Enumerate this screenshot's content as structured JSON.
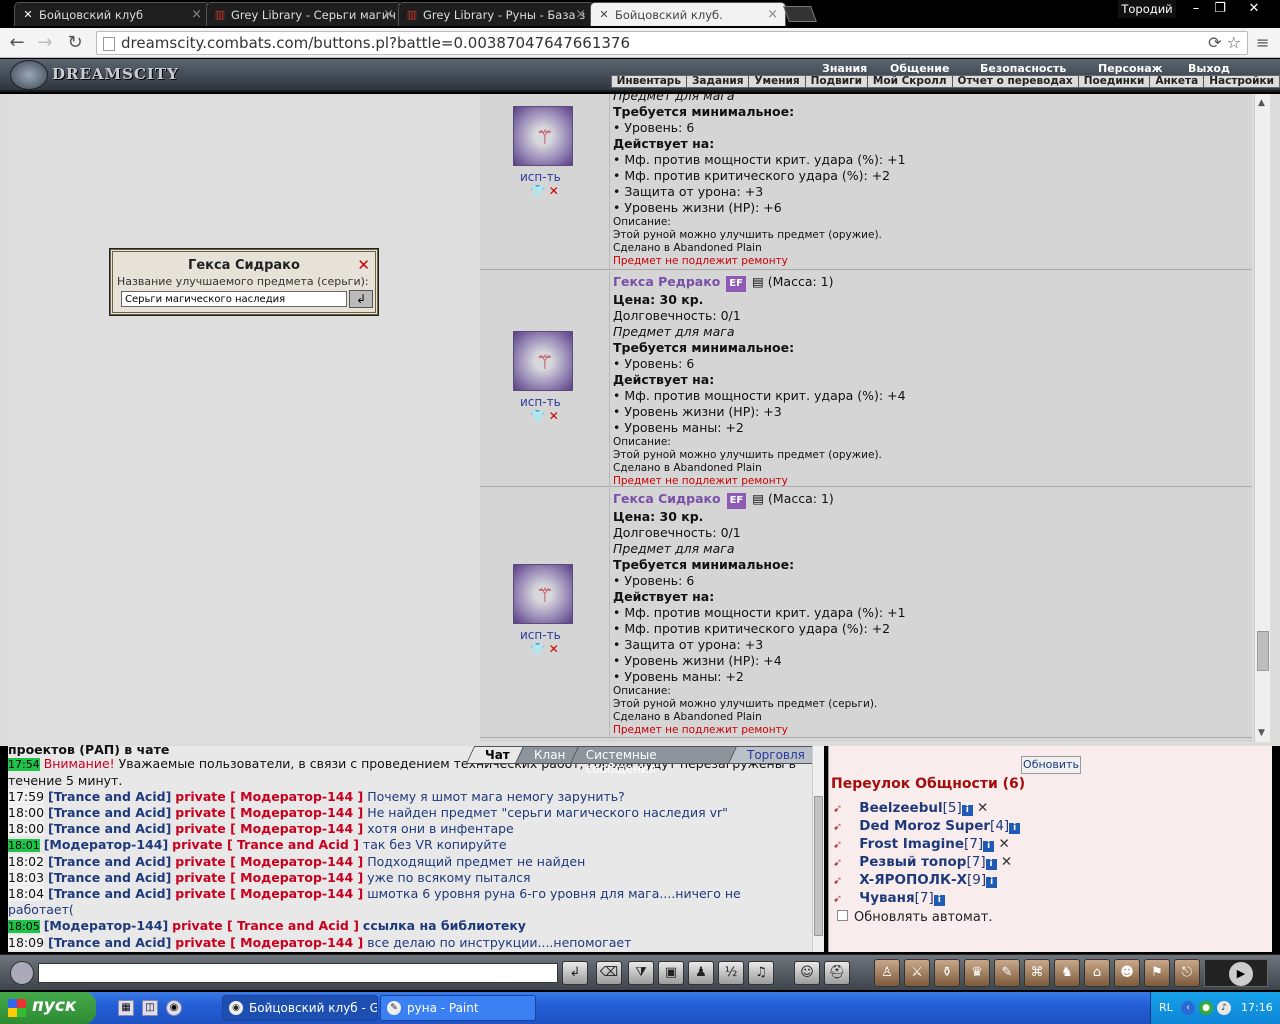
{
  "browser": {
    "tabs": [
      {
        "title": "Бойцовский клуб",
        "icon": "fight-club-icon",
        "active": false
      },
      {
        "title": "Grey Library - Серьги магич",
        "icon": "library-icon",
        "active": false
      },
      {
        "title": "Grey Library - Руны - База з",
        "icon": "library-icon",
        "active": false
      },
      {
        "title": "Бойцовский клуб.",
        "icon": "fight-club-icon",
        "active": true
      }
    ],
    "profile": "Тородий",
    "url": "dreamscity.combats.com/buttons.pl?battle=0.00387047647661376"
  },
  "site": {
    "logo": "DREAMSCITY",
    "top_menu": [
      "Знания",
      "Общение",
      "Безопасность",
      "Персонаж",
      "Выход"
    ],
    "sub_menu": [
      "Инвентарь",
      "Задания",
      "Умения",
      "Подвиги",
      "Мой Скролл",
      "Отчет о переводах",
      "Поединки",
      "Анкета",
      "Настройки"
    ]
  },
  "dialog": {
    "title": "Гекса Сидрако",
    "label": "Название улучшаемого предмета (серьги):",
    "value": "Серьги магического наследия"
  },
  "items": [
    {
      "partial_top": "Предмет для мага",
      "req_title": "Требуется минимальное:",
      "req": [
        "• Уровень: 6"
      ],
      "acts_title": "Действует на:",
      "acts": [
        "• Мф. против мощности крит. удара (%): +1",
        "• Мф. против критического удара (%): +2",
        "• Защита от урона: +3",
        "• Уровень жизни (HP): +6"
      ],
      "desc_title": "Описание:",
      "desc": "Этой руной можно улучшить предмет (оружие).",
      "made": "Сделано в Abandoned Plain",
      "norepair": "Предмет не подлежит ремонту",
      "use": "исп-ть"
    },
    {
      "name": "Гекса Редрако",
      "ef": "EF",
      "mass": "(Масса: 1)",
      "price": "Цена: 30 кр.",
      "dur": "Долговечность: 0/1",
      "for": "Предмет для мага",
      "req_title": "Требуется минимальное:",
      "req": [
        "• Уровень: 6"
      ],
      "acts_title": "Действует на:",
      "acts": [
        "• Мф. против мощности крит. удара (%): +4",
        "• Уровень жизни (HP): +3",
        "• Уровень маны: +2"
      ],
      "desc_title": "Описание:",
      "desc": "Этой руной можно улучшить предмет (оружие).",
      "made": "Сделано в Abandoned Plain",
      "norepair": "Предмет не подлежит ремонту",
      "use": "исп-ть"
    },
    {
      "name": "Гекса Сидрако",
      "ef": "EF",
      "mass": "(Масса: 1)",
      "price": "Цена: 30 кр.",
      "dur": "Долговечность: 0/1",
      "for": "Предмет для мага",
      "req_title": "Требуется минимальное:",
      "req": [
        "• Уровень: 6"
      ],
      "acts_title": "Действует на:",
      "acts": [
        "• Мф. против мощности крит. удара (%): +1",
        "• Мф. против критического удара (%): +2",
        "• Защита от урона: +3",
        "• Уровень жизни (HP): +4",
        "• Уровень маны: +2"
      ],
      "desc_title": "Описание:",
      "desc": "Этой руной можно улучшить предмет (серьги).",
      "made": "Сделано в Abandoned Plain",
      "norepair": "Предмет не подлежит ремонту",
      "use": "исп-ть"
    }
  ],
  "chat": {
    "tabs": [
      "Чат",
      "Клан",
      "Системные сообщения",
      "Торговля"
    ],
    "header_partial": "проектов (РАП) в чате",
    "lines": [
      {
        "time": "17:54",
        "green": true,
        "type": "warn",
        "warn": "Внимание!",
        "text": " Уважаемые пользователи, в связи с проведением технических работ, города будут перезагружены в течение 5 минут."
      },
      {
        "time": "17:59",
        "from": "[Trance and Acid]",
        "priv": "private [ Модератор-144 ]",
        "text": "Почему я шмот мага немогу зарунить?"
      },
      {
        "time": "18:00",
        "from": "[Trance and Acid]",
        "priv": "private [ Модератор-144 ]",
        "text": "Не найден предмет \"серьги магического наследия vr\""
      },
      {
        "time": "18:00",
        "from": "[Trance and Acid]",
        "priv": "private [ Модератор-144 ]",
        "text": "хотя они в инфентаре"
      },
      {
        "time": "18:01",
        "green": true,
        "from": "[Модератор-144]",
        "priv": "private [ Trance and Acid ]",
        "text": "так без VR копируйте"
      },
      {
        "time": "18:02",
        "from": "[Trance and Acid]",
        "priv": "private [ Модератор-144 ]",
        "text": "Подходящий предмет не найден"
      },
      {
        "time": "18:03",
        "from": "[Trance and Acid]",
        "priv": "private [ Модератор-144 ]",
        "text": "уже по всякому пытался"
      },
      {
        "time": "18:04",
        "from": "[Trance and Acid]",
        "priv": "private [ Модератор-144 ]",
        "text": "шмотка 6 уровня руна 6-го уровня для мага....ничего не работает("
      },
      {
        "time": "18:05",
        "green": true,
        "from": "[Модератор-144]",
        "priv": "private [ Trance and Acid ]",
        "text": "ссылка на библиотеку",
        "boldtext": true
      },
      {
        "time": "18:09",
        "from": "[Trance and Acid]",
        "priv": "private [ Модератор-144 ]",
        "text": "все делаю по инструкции....непомогает"
      }
    ]
  },
  "online": {
    "refresh": "Обновить",
    "location": "Переулок Общности (6)",
    "users": [
      {
        "name": "Beelzeebul",
        "level": "[5]",
        "x": true
      },
      {
        "name": "Ded Moroz Super",
        "level": "[4]",
        "x": false
      },
      {
        "name": "Frost Imagine",
        "level": "[7]",
        "x": true
      },
      {
        "name": "Резвый топор",
        "level": "[7]",
        "x": true
      },
      {
        "name": "X-ЯРОПОЛК-X",
        "level": "[9]",
        "x": false
      },
      {
        "name": "Чуваня",
        "level": "[7]",
        "x": false
      }
    ],
    "auto_refresh": "Обновлять автомат."
  },
  "taskbar": {
    "start": "пуск",
    "tasks": [
      "Бойцовский клуб - G...",
      "руна - Paint"
    ],
    "lang": "RL",
    "time": "17:16"
  }
}
